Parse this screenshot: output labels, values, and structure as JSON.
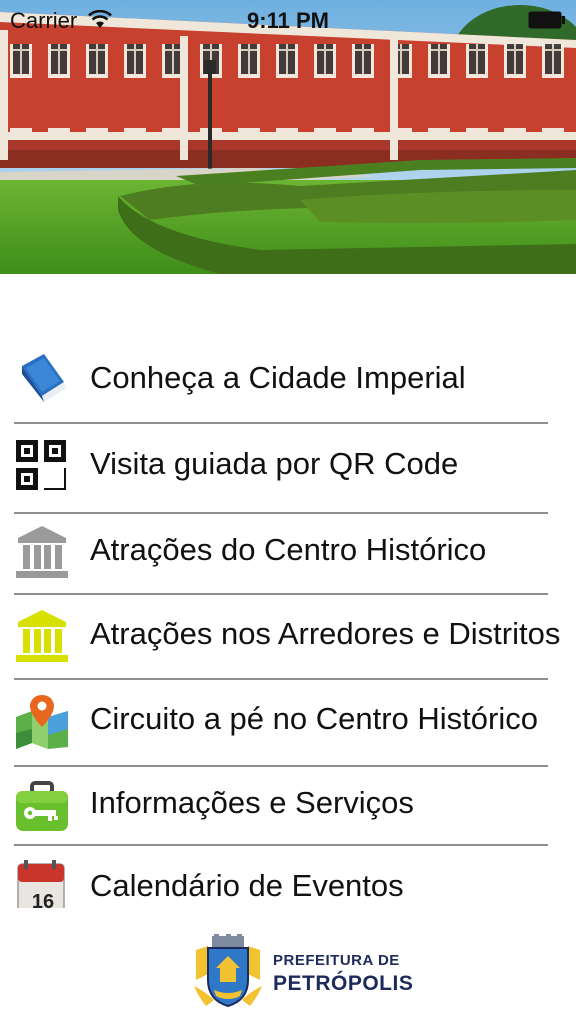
{
  "status_bar": {
    "carrier": "Carrier",
    "time": "9:11 PM"
  },
  "menu": {
    "items": [
      {
        "label": "Conheça a Cidade Imperial",
        "icon": "book-icon"
      },
      {
        "label": "Visita guiada por QR Code",
        "icon": "qr-code-icon"
      },
      {
        "label": "Atrações do Centro Histórico",
        "icon": "museum-icon"
      },
      {
        "label": "Atrações nos Arredores e Distritos",
        "icon": "museum-yellow-icon"
      },
      {
        "label": "Circuito a pé no Centro Histórico",
        "icon": "map-pin-icon"
      },
      {
        "label": "Informações e Serviços",
        "icon": "toolbox-icon"
      },
      {
        "label": "Calendário de Eventos",
        "icon": "calendar-icon"
      }
    ],
    "calendar_day": "16"
  },
  "footer": {
    "line1": "PREFEITURA DE",
    "line2": "PETRÓPOLIS"
  },
  "colors": {
    "building_red": "#c8412f",
    "grass": "#5aa02a",
    "hedge": "#4d7d20",
    "logo_text": "#1d2a5c",
    "separator": "#8e8e8e"
  }
}
